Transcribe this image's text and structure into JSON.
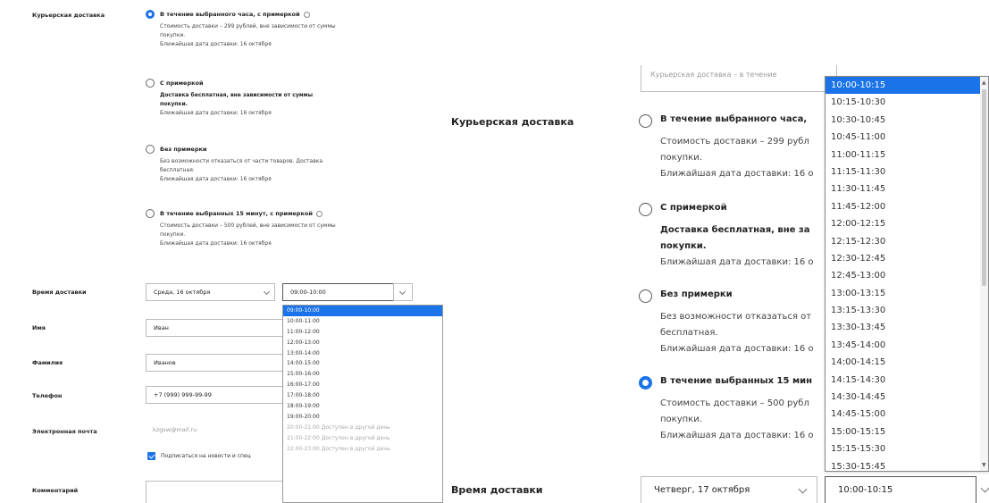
{
  "left": {
    "labels": {
      "courier": "Курьерская доставка",
      "time": "Время доставки",
      "name": "Имя",
      "surname": "Фамилия",
      "phone": "Телефон",
      "email": "Электронная почта",
      "comment": "Комментарий"
    },
    "options": [
      {
        "title": "В течение выбранного часа, с примеркой",
        "lines": [
          "Стоимость доставки – 299 рублей, вне зависимости от суммы",
          "покупки.",
          "Ближайшая дата доставки: 16 октября"
        ]
      },
      {
        "title": "С примеркой",
        "lines": [
          "Доставка бесплатная, вне зависимости от суммы",
          "покупки.",
          "Ближайшая дата доставки: 16 октября"
        ]
      },
      {
        "title": "Без примерки",
        "lines": [
          "Без возможности отказаться от части товаров. Доставка",
          "бесплатная.",
          "Ближайшая дата доставки: 16 октября"
        ]
      },
      {
        "title": "В течение выбранных 15 минут, с примеркой",
        "lines": [
          "Стоимость доставки – 500 рублей, вне зависимости от суммы",
          "покупки.",
          "Ближайшая дата доставки: 16 октября"
        ]
      }
    ],
    "date_select": "Среда, 16 октября",
    "time_select": "09:00-10:00",
    "name_value": "Иван",
    "surname_value": "Иванов",
    "phone_value": "+7 (999) 999-99-99",
    "email_placeholder": "kzgsw@mail.ru",
    "subscribe_label": "Подписаться на новости и спец",
    "time_options": [
      "09:00-10:00",
      "10:00-11:00",
      "11:00-12:00",
      "12:00-13:00",
      "13:00-14:00",
      "14:00-15:00",
      "15:00-16:00",
      "16:00-17:00",
      "17:00-18:00",
      "18:00-19:00",
      "19:00-20:00",
      "20:00-21:00 Доступен в другой день",
      "21:00-22:00 Доступен в другой день",
      "22:00-23:00 Доступен в другой день"
    ]
  },
  "right": {
    "top_box_text": "Курьерская доставка – в течение",
    "labels": {
      "courier": "Курьерская доставка",
      "time": "Время доставки"
    },
    "options": [
      {
        "title": "В течение выбранного часа,",
        "lines": [
          "Стоимость доставки – 299 рубл",
          "покупки.",
          "Ближайшая дата доставки: 16 о"
        ]
      },
      {
        "title": "С примеркой",
        "lines": [
          "Доставка бесплатная, вне за",
          "покупки.",
          "Ближайшая дата доставки: 16 о"
        ]
      },
      {
        "title": "Без примерки",
        "lines": [
          "Без возможности отказаться от",
          "бесплатная.",
          "Ближайшая дата доставки: 16 о"
        ]
      },
      {
        "title": "В течение выбранных 15 мин",
        "lines": [
          "Стоимость доставки – 500 рубл",
          "покупки.",
          "Ближайшая дата доставки: 16 о"
        ]
      }
    ],
    "date_select": "Четверг, 17 октября",
    "time_select": "10:00-10:15",
    "time_options": [
      "10:00-10:15",
      "10:15-10:30",
      "10:30-10:45",
      "10:45-11:00",
      "11:00-11:15",
      "11:15-11:30",
      "11:30-11:45",
      "11:45-12:00",
      "12:00-12:15",
      "12:15-12:30",
      "12:30-12:45",
      "12:45-13:00",
      "13:00-13:15",
      "13:15-13:30",
      "13:30-13:45",
      "13:45-14:00",
      "14:00-14:15",
      "14:15-14:30",
      "14:30-14:45",
      "14:45-15:00",
      "15:00-15:15",
      "15:15-15:30",
      "15:30-15:45"
    ]
  }
}
